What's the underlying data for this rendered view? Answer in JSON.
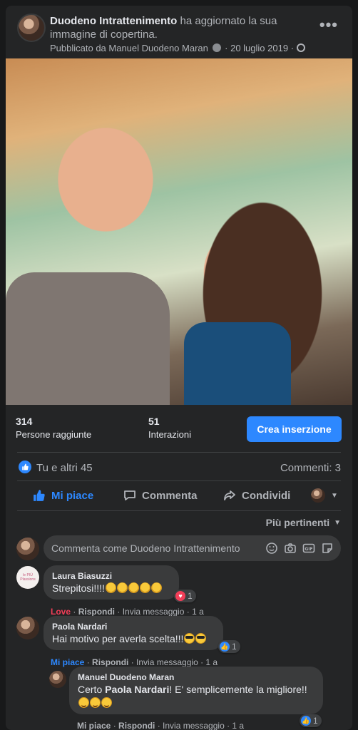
{
  "post": {
    "author": "Duodeno Intrattenimento",
    "action": "ha aggiornato la sua immagine di copertina.",
    "published_by": "Pubblicato da Manuel Duodeno Maran",
    "date": "20 luglio 2019",
    "separator": "·"
  },
  "stats": {
    "reach_value": "314",
    "reach_label": "Persone raggiunte",
    "interactions_value": "51",
    "interactions_label": "Interazioni",
    "cta_label": "Crea inserzione"
  },
  "reactions": {
    "summary": "Tu e altri 45",
    "comments": "Commenti: 3"
  },
  "actions": {
    "like": "Mi piace",
    "comment": "Commenta",
    "share": "Condividi"
  },
  "sort": {
    "label": "Più pertinenti"
  },
  "composer": {
    "placeholder": "Commenta come Duodeno Intrattenimento"
  },
  "comments": [
    {
      "author": "Laura Biasuzzi",
      "text": "Strepitosi!!!!",
      "reaction_count": "1",
      "reaction_label": "Love",
      "reply": "Rispondi",
      "message": "Invia messaggio",
      "time": "1 a"
    },
    {
      "author": "Paola Nardari",
      "text": "Hai motivo per averla scelta!!!",
      "reaction_count": "1",
      "reaction_label": "Mi piace",
      "reply": "Rispondi",
      "message": "Invia messaggio",
      "time": "1 a"
    },
    {
      "author": "Manuel Duodeno Maran",
      "text_before": "Certo ",
      "mention": "Paola Nardari",
      "text_after": "! E' semplicemente la migliore!!",
      "reaction_count": "1",
      "reaction_label": "Mi piace",
      "reply": "Rispondi",
      "message": "Invia messaggio",
      "time": "1 a"
    }
  ],
  "colors": {
    "accent": "#2d88ff",
    "love": "#f33e58",
    "card": "#242526",
    "background": "#18191a"
  }
}
